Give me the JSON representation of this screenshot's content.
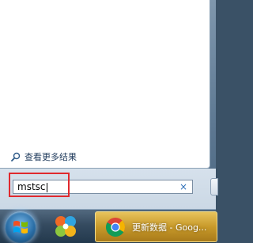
{
  "start_menu": {
    "see_more_label": "查看更多结果",
    "search": {
      "value": "mstsc",
      "clear_glyph": "×"
    }
  },
  "taskbar": {
    "active_task_label": "更新数据 - Goog..."
  },
  "icons": {
    "see_more": "search-icon",
    "clear": "close-icon",
    "start": "windows-logo-icon",
    "pinned": "pinwheel-app-icon",
    "task": "chrome-icon"
  },
  "colors": {
    "highlight": "#e0292e",
    "task_active": "#c89a2a"
  }
}
